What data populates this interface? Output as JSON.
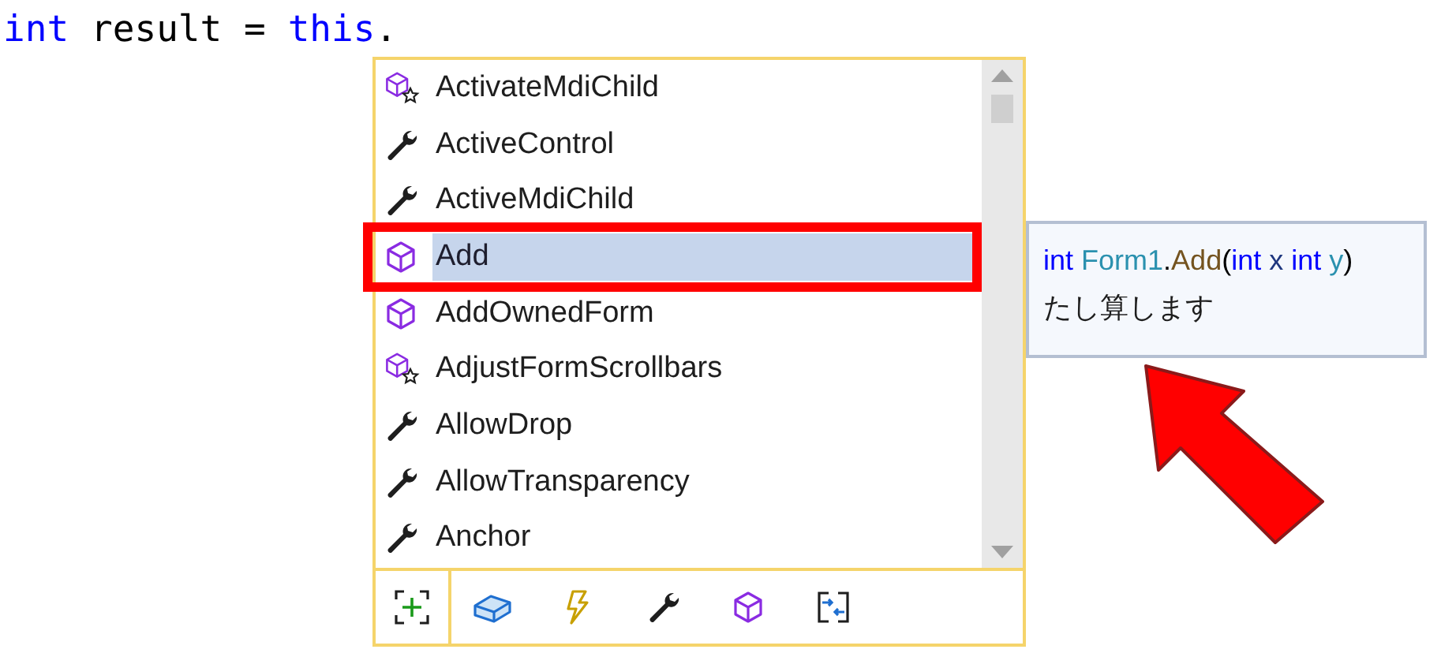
{
  "code_line": [
    {
      "text": "int",
      "kind": "keyword"
    },
    {
      "text": "result =",
      "kind": "plain"
    },
    {
      "text": "this",
      "kind": "keyword"
    },
    {
      "text": ".",
      "kind": "plain"
    }
  ],
  "completion_list": {
    "items": [
      {
        "label": "ActivateMdiChild",
        "kind": "extension",
        "selected": false
      },
      {
        "label": "ActiveControl",
        "kind": "property",
        "selected": false
      },
      {
        "label": "ActiveMdiChild",
        "kind": "property",
        "selected": false
      },
      {
        "label": "Add",
        "kind": "method",
        "selected": true
      },
      {
        "label": "AddOwnedForm",
        "kind": "method",
        "selected": false
      },
      {
        "label": "AdjustFormScrollbars",
        "kind": "extension",
        "selected": false
      },
      {
        "label": "AllowDrop",
        "kind": "property",
        "selected": false
      },
      {
        "label": "AllowTransparency",
        "kind": "property",
        "selected": false
      },
      {
        "label": "Anchor",
        "kind": "property",
        "selected": false
      }
    ],
    "filters": [
      {
        "kind": "field"
      },
      {
        "kind": "event"
      },
      {
        "kind": "property"
      },
      {
        "kind": "method"
      },
      {
        "kind": "interface"
      }
    ]
  },
  "tooltip": {
    "signature": [
      {
        "text": "int ",
        "kind": "keyword"
      },
      {
        "text": "Form1",
        "kind": "type"
      },
      {
        "text": ".",
        "kind": "plain"
      },
      {
        "text": "Add",
        "kind": "method"
      },
      {
        "text": "(",
        "kind": "plain"
      },
      {
        "text": "int",
        "kind": "keyword"
      },
      {
        "text": " x ",
        "kind": "param"
      },
      {
        "text": "int",
        "kind": "keyword"
      },
      {
        "text": " y",
        "kind": "type"
      },
      {
        "text": ")",
        "kind": "plain"
      }
    ],
    "description": "たし算します"
  }
}
